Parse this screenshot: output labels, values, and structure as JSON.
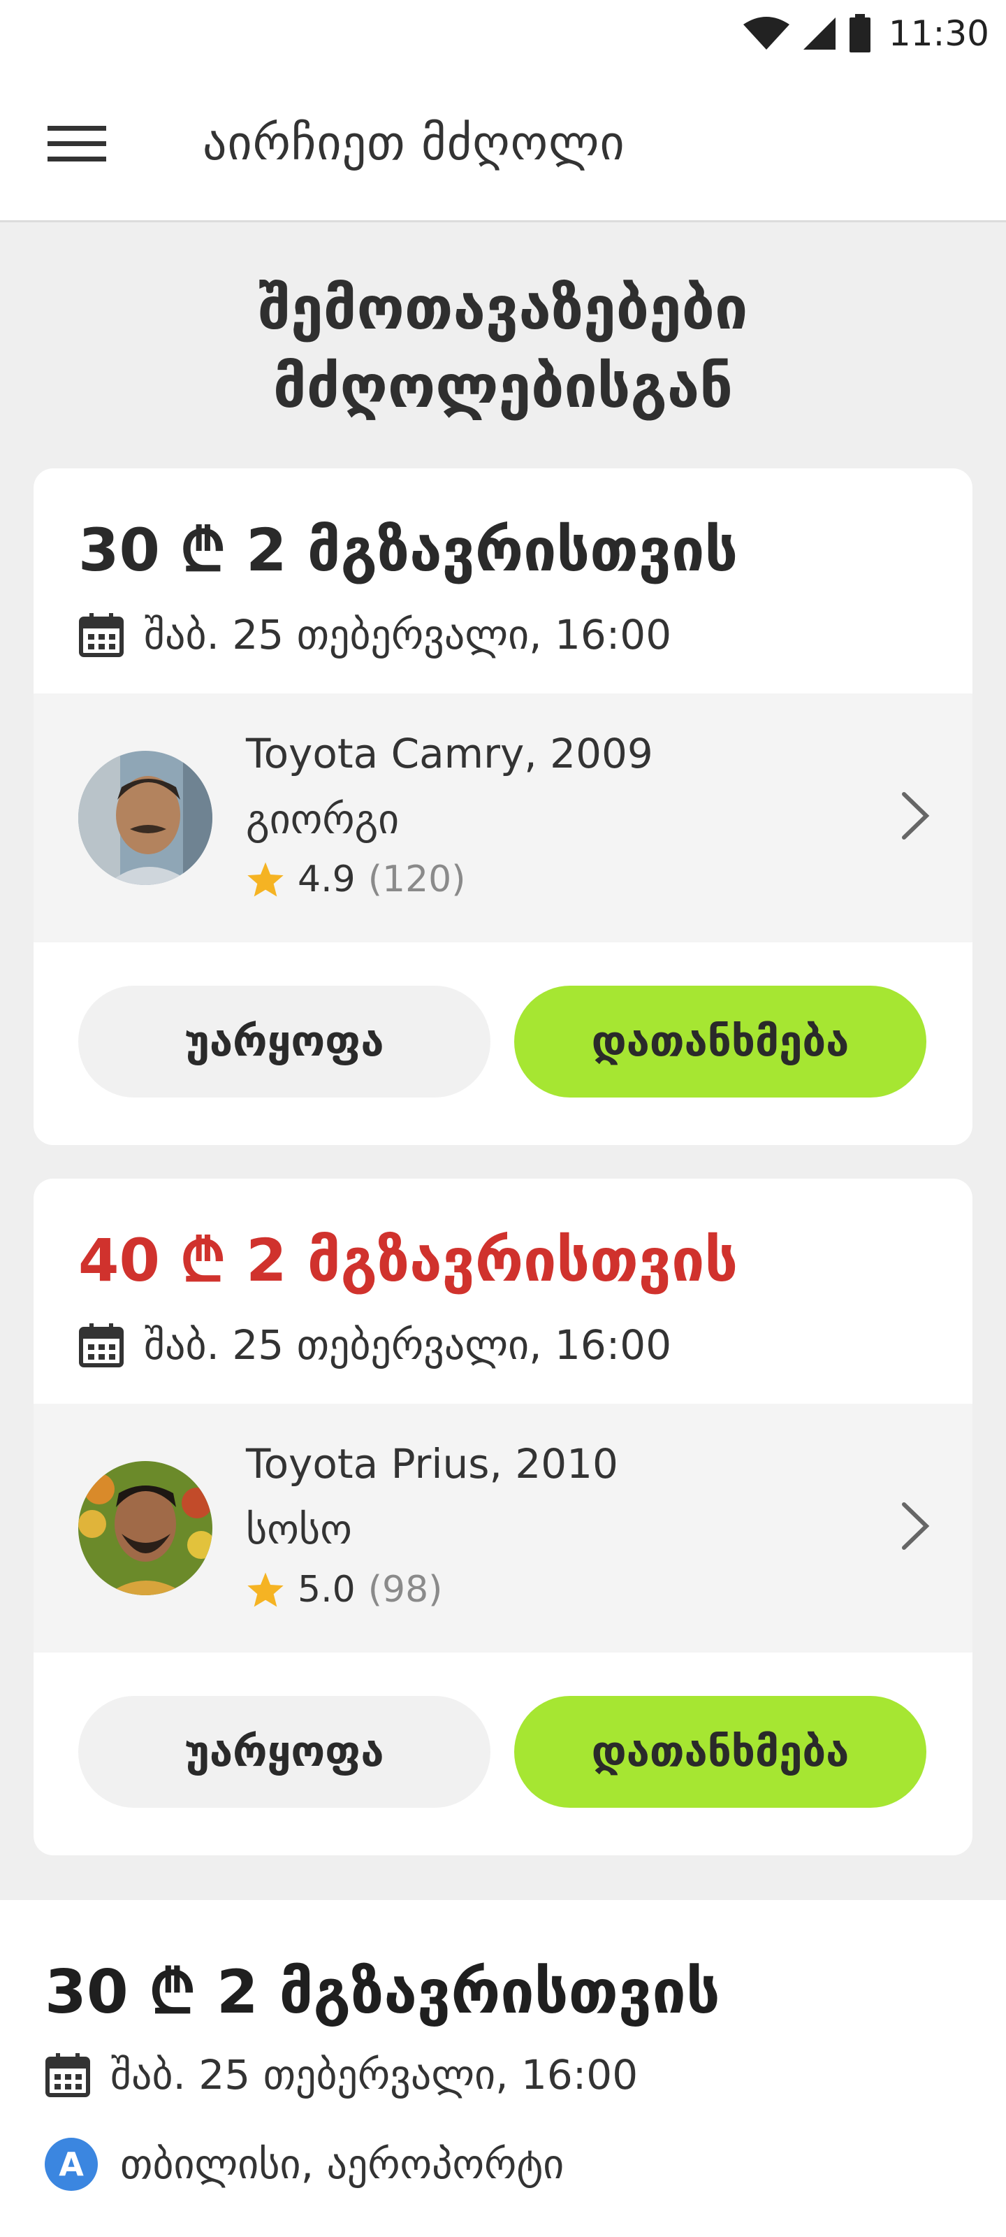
{
  "status_bar": {
    "time": "11:30"
  },
  "app_bar": {
    "title": "აირჩიეთ მძღოლი"
  },
  "section": {
    "title_line1": "შემოთავაზებები",
    "title_line2": "მძღოლებისგან"
  },
  "offers": [
    {
      "price": "30 ₾ 2 მგზავრისთვის",
      "price_color": "#2a2a2a",
      "date": "შაბ. 25 თებერვალი, 16:00",
      "car": "Toyota Camry, 2009",
      "driver": "გიორგი",
      "rating": "4.9",
      "rating_count": "(120)",
      "decline_label": "უარყოფა",
      "accept_label": "დათანხმება"
    },
    {
      "price": "40 ₾ 2 მგზავრისთვის",
      "price_color": "#d0322d",
      "date": "შაბ. 25 თებერვალი, 16:00",
      "car": "Toyota Prius, 2010",
      "driver": "სოსო",
      "rating": "5.0",
      "rating_count": "(98)",
      "decline_label": "უარყოფა",
      "accept_label": "დათანხმება"
    }
  ],
  "bottom_sheet": {
    "price": "30 ₾ 2 მგზავრისთვის",
    "date": "შაბ. 25 თებერვალი, 16:00",
    "location_badge": "A",
    "location": "თბილისი, აეროპორტი"
  },
  "colors": {
    "accent": "#a6e632",
    "alert": "#d0322d",
    "badge": "#3b86e0",
    "star": "#f5b323"
  }
}
